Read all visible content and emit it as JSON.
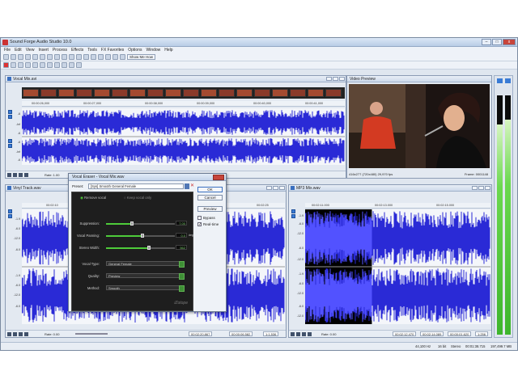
{
  "app": {
    "title": "Sound Forge Audio Studio 10.0"
  },
  "menu": [
    "File",
    "Edit",
    "View",
    "Insert",
    "Process",
    "Effects",
    "Tools",
    "FX Favorites",
    "Options",
    "Window",
    "Help"
  ],
  "toolbar": {
    "show_me_how": "Show Me How"
  },
  "windows": {
    "vocal_mix": {
      "title": "Vocal Mix.avi",
      "ruler": [
        "00:00:26,000",
        "00:00:27,000",
        "00:00:38,000",
        "00:00:39,000",
        "00:00:40,000",
        "00:00:41,000"
      ],
      "rate": "Rate: 1.00",
      "db": [
        "-6",
        "-Inf",
        "-6",
        "-6",
        "-Inf",
        "-6"
      ]
    },
    "video_preview": {
      "title": "Video Preview",
      "info": "416x277 (720x480) 29,970 fps",
      "frame": "Frame: 0001148"
    },
    "vinyl_track": {
      "title": "Vinyl Track.wav",
      "ruler": [
        "00:02:10",
        "00:02:20",
        "00:02:25"
      ],
      "db": [
        "-1.9",
        "-6.0",
        "-12.0",
        "-6.0",
        "-1.9",
        "-6.0",
        "-12.0",
        "-6.0"
      ],
      "rate": "Rate: 0.00",
      "time1": "00:02:20.867",
      "time2": "00:00:06.582",
      "ratio": "1:1,536"
    },
    "mp3_mix": {
      "title": "MP3 Mix.wav",
      "ruler": [
        "00:02:11.000",
        "00:02:13.000",
        "00:02:15.000"
      ],
      "db": [
        "-1.9",
        "-6.0",
        "-12.0",
        "-6.0",
        "-12.0",
        "-1.9",
        "-6.0",
        "-12.0",
        "-6.0",
        "-12.0"
      ],
      "rate": "Rate: 0.00",
      "time1": "00:02:12.470",
      "time2": "00:02:14.089",
      "time3": "00:00:01.620",
      "ratio": "1:256"
    }
  },
  "dialog": {
    "title": "Vocal Eraser - Vocal Mix.wav",
    "preset_label": "Preset:",
    "preset_value": "[Sys] Smooth General Female",
    "remove_vocal": "Remove vocal",
    "keep_vocal": "Keep vocal only",
    "ok": "OK",
    "cancel": "Cancel",
    "preview": "Preview",
    "bypass": "Bypass",
    "realtime": "Real-time",
    "brand": "iZotope",
    "sliders": [
      {
        "label": "Suppression:",
        "value": "7.00",
        "fraction": 0.35,
        "unit": ""
      },
      {
        "label": "Vocal Panning:",
        "value": "0.0",
        "fraction": 0.5,
        "unit": "deg"
      },
      {
        "label": "Stereo Width:",
        "value": "562",
        "fraction": 0.6,
        "unit": ""
      }
    ],
    "selects": [
      {
        "label": "Vocal Type:",
        "value": "General Female"
      },
      {
        "label": "Quality:",
        "value": "Preview"
      },
      {
        "label": "Method:",
        "value": "Smooth"
      }
    ]
  },
  "status": {
    "sample_rate": "44,100 Hz",
    "bits": "16 bit",
    "channels": "Stereo",
    "length": "00:01:38.715",
    "size": "197,499.7 MB"
  },
  "colors": {
    "wave": "#2a2ad6",
    "select": "#5252ff",
    "meter": "#3db52c"
  }
}
